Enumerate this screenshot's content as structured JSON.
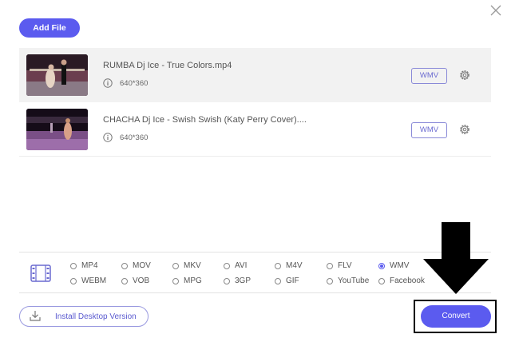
{
  "toolbar": {
    "add_file_label": "Add File"
  },
  "files": [
    {
      "name": "RUMBA Dj Ice - True Colors.mp4",
      "resolution": "640*360",
      "format": "WMV"
    },
    {
      "name": "CHACHA Dj Ice - Swish Swish (Katy Perry Cover)....",
      "resolution": "640*360",
      "format": "WMV"
    }
  ],
  "formats": {
    "selected": "WMV",
    "options": [
      "MP4",
      "MOV",
      "MKV",
      "AVI",
      "M4V",
      "FLV",
      "WMV",
      "WEBM",
      "VOB",
      "MPG",
      "3GP",
      "GIF",
      "YouTube",
      "Facebook"
    ]
  },
  "footer": {
    "install_label": "Install Desktop Version",
    "convert_label": "Convert"
  },
  "colors": {
    "accent": "#5b5bef",
    "row_highlight": "#f2f2f2"
  }
}
